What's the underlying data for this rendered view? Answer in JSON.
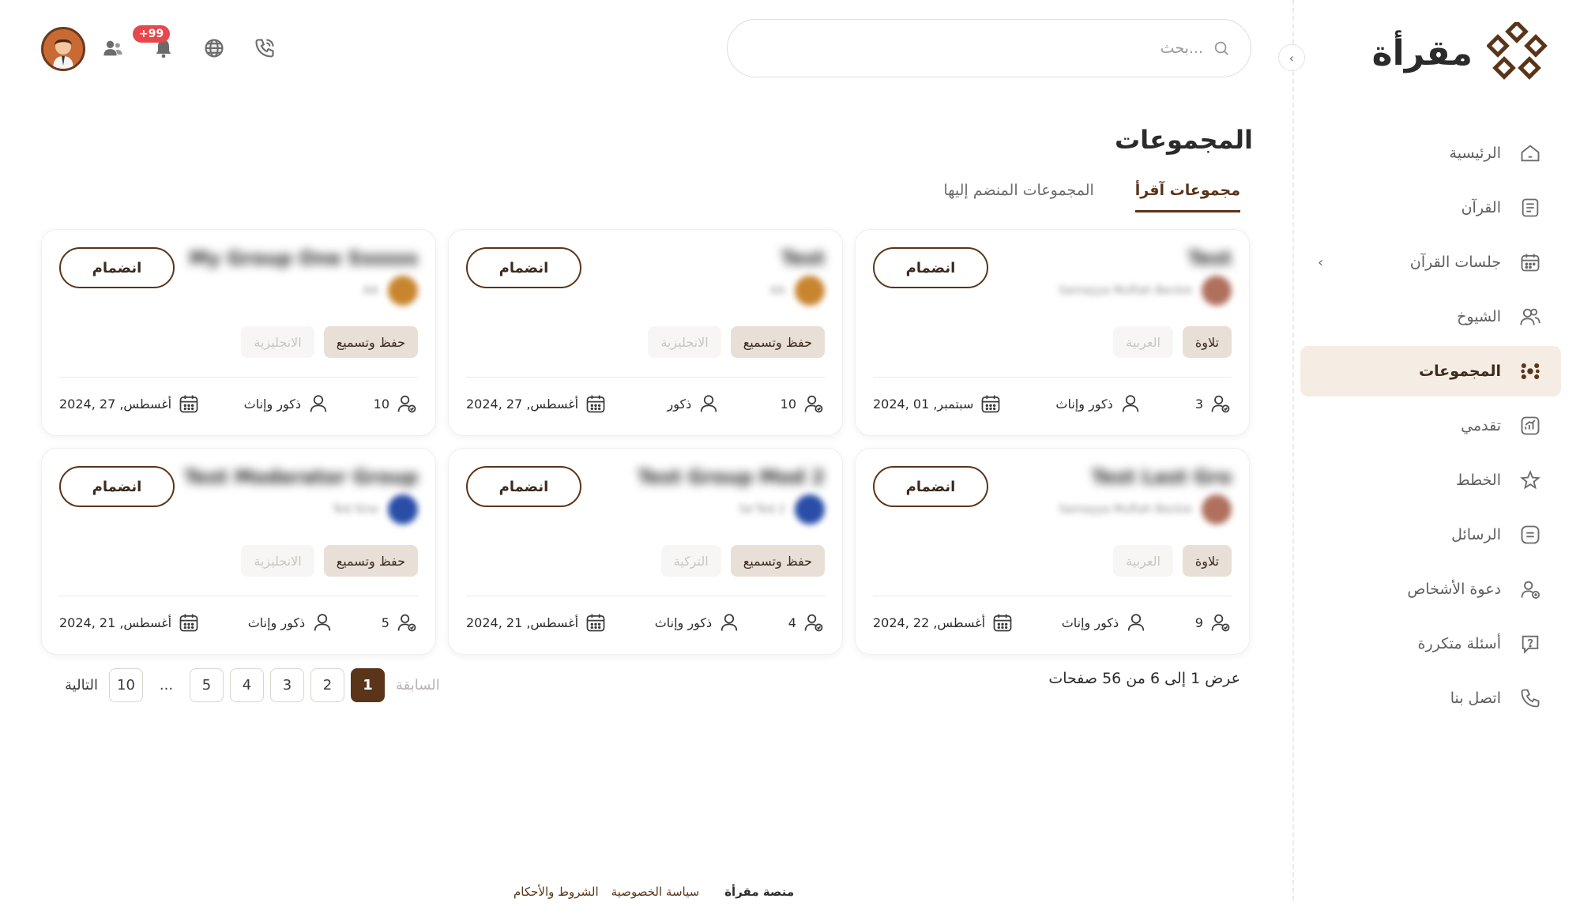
{
  "app": {
    "logo_text": "مقرأة"
  },
  "search": {
    "placeholder": "بحث..."
  },
  "notifications": {
    "badge": "+99"
  },
  "sidebar": {
    "items": [
      {
        "label": "الرئيسية",
        "icon": "home-icon"
      },
      {
        "label": "القرآن",
        "icon": "book-icon"
      },
      {
        "label": "جلسات القرآن",
        "icon": "calendar-icon"
      },
      {
        "label": "الشيوخ",
        "icon": "users-icon"
      },
      {
        "label": "المجموعات",
        "icon": "groups-icon"
      },
      {
        "label": "تقدمي",
        "icon": "chart-icon"
      },
      {
        "label": "الخطط",
        "icon": "plan-icon"
      },
      {
        "label": "الرسائل",
        "icon": "message-icon"
      },
      {
        "label": "دعوة الأشخاص",
        "icon": "invite-icon"
      },
      {
        "label": "أسئلة متكررة",
        "icon": "faq-icon"
      },
      {
        "label": "اتصل بنا",
        "icon": "phone-icon"
      }
    ]
  },
  "page": {
    "title": "المجموعات",
    "tabs": [
      {
        "label": "مجموعات آقرأ"
      },
      {
        "label": "المجموعات المنضم إليها"
      }
    ]
  },
  "cards": [
    {
      "name": "Test",
      "sub": "Samayya Muftah Beckie",
      "type": "تلاوة",
      "lang": "العربية",
      "members": "3",
      "gender": "ذكور وإناث",
      "date": "سبتمبر, 01 ,2024",
      "join": "انضمام",
      "avatar_color": "#b0705e"
    },
    {
      "name": "Test",
      "sub": "AA",
      "type": "حفظ وتسميع",
      "lang": "الانجليزية",
      "members": "10",
      "gender": "ذكور",
      "date": "أغسطس, 27 ,2024",
      "join": "انضمام",
      "avatar_color": "#c8852e"
    },
    {
      "name": "My Group One Ssssss",
      "sub": "AA",
      "type": "حفظ وتسميع",
      "lang": "الانجليزية",
      "members": "10",
      "gender": "ذكور وإناث",
      "date": "أغسطس, 27 ,2024",
      "join": "انضمام",
      "avatar_color": "#c8852e"
    },
    {
      "name": "Test Last Gro",
      "sub": "Samayya Muftah Beckie",
      "type": "تلاوة",
      "lang": "العربية",
      "members": "9",
      "gender": "ذكور وإناث",
      "date": "أغسطس, 22 ,2024",
      "join": "انضمام",
      "avatar_color": "#b0705e"
    },
    {
      "name": "Test Group Mod 2",
      "sub": "Se'Ted 2",
      "type": "حفظ وتسميع",
      "lang": "التركية",
      "members": "4",
      "gender": "ذكور وإناث",
      "date": "أغسطس, 21 ,2024",
      "join": "انضمام",
      "avatar_color": "#2a4da8"
    },
    {
      "name": "Test Moderator Group",
      "sub": "Ted Sine",
      "type": "حفظ وتسميع",
      "lang": "الانجليزية",
      "members": "5",
      "gender": "ذكور وإناث",
      "date": "أغسطس, 21 ,2024",
      "join": "انضمام",
      "avatar_color": "#2a4da8"
    }
  ],
  "pagination": {
    "info": "عرض 1 إلى 6 من 56 صفحات",
    "prev": "السابقة",
    "next": "التالية",
    "pages": [
      "1",
      "2",
      "3",
      "4",
      "5"
    ],
    "dots": "...",
    "last": "10",
    "current": "1"
  },
  "footer": {
    "brand": "منصة مقرأة",
    "privacy": "سياسة الخصوصية",
    "terms": "الشروط والأحكام"
  },
  "colors": {
    "accent": "#5a3519",
    "active_bg": "#f5ece3",
    "badge": "#e5484d"
  }
}
